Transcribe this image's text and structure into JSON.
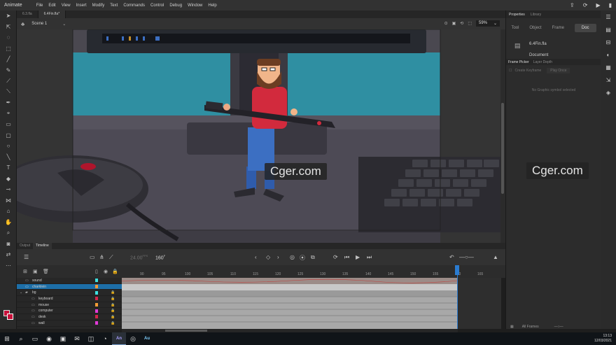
{
  "app": {
    "name": "Animate",
    "menus": [
      "File",
      "Edit",
      "View",
      "Insert",
      "Modify",
      "Text",
      "Commands",
      "Control",
      "Debug",
      "Window",
      "Help"
    ]
  },
  "doc_tabs": [
    "6.3.fla",
    "6.4Fin.fla*"
  ],
  "scene": {
    "label": "Scene 1",
    "zoom": "59%"
  },
  "stage": {
    "watermark_center": "Cger.com",
    "accent_colors": {
      "teal": "#2f8fa2",
      "screen_dark": "#2a2f3a",
      "desk": "#4d4a52",
      "shirt": "#d22a3d",
      "pants": "#3c6fc2"
    }
  },
  "panel_tabs": [
    "Output",
    "Timeline"
  ],
  "timeline": {
    "fps": "24.00",
    "fps_unit": "FPS",
    "current_frame": "160",
    "current_frame_unit": "F",
    "ruler": [
      "90",
      "95",
      "100",
      "105",
      "110",
      "115",
      "120",
      "125",
      "130",
      "135",
      "140",
      "145",
      "150",
      "155",
      "160",
      "165"
    ],
    "layers": [
      {
        "name": "sound",
        "color": "#3ee1e1",
        "indent": 0,
        "selected": false,
        "locked": false
      },
      {
        "name": "charklein",
        "color": "#f39c35",
        "indent": 0,
        "selected": true,
        "locked": false
      },
      {
        "name": "bg",
        "color": "#3ee1e1",
        "indent": 0,
        "selected": false,
        "locked": true,
        "folder": true
      },
      {
        "name": "keyboard",
        "color": "#d3254a",
        "indent": 1,
        "selected": false,
        "locked": true
      },
      {
        "name": "mouse",
        "color": "#f39c35",
        "indent": 1,
        "selected": false,
        "locked": true
      },
      {
        "name": "computer",
        "color": "#e23ad8",
        "indent": 1,
        "selected": false,
        "locked": true
      },
      {
        "name": "desk",
        "color": "#d3254a",
        "indent": 1,
        "selected": false,
        "locked": true
      },
      {
        "name": "wall",
        "color": "#e23ad8",
        "indent": 1,
        "selected": false,
        "locked": true
      }
    ]
  },
  "right_panel": {
    "tabs": [
      "Properties",
      "Library"
    ],
    "sub_tabs": [
      "Tool",
      "Object",
      "Frame",
      "Doc"
    ],
    "active_sub_tab": "Doc",
    "file_name": "6.4Fin.fla",
    "doc_label": "Document",
    "frame_picker_tabs": [
      "Frame Picker",
      "Layer Depth"
    ],
    "create_keyframe": "Create Keyframe",
    "play_once": "Play Once",
    "empty_message": "No Graphic symbol selected",
    "watermark": "Cger.com",
    "footer_frames": "All Frames"
  },
  "taskbar": {
    "apps": [
      "An",
      "Au"
    ],
    "time": "13:13",
    "date": "12/03/2021"
  }
}
